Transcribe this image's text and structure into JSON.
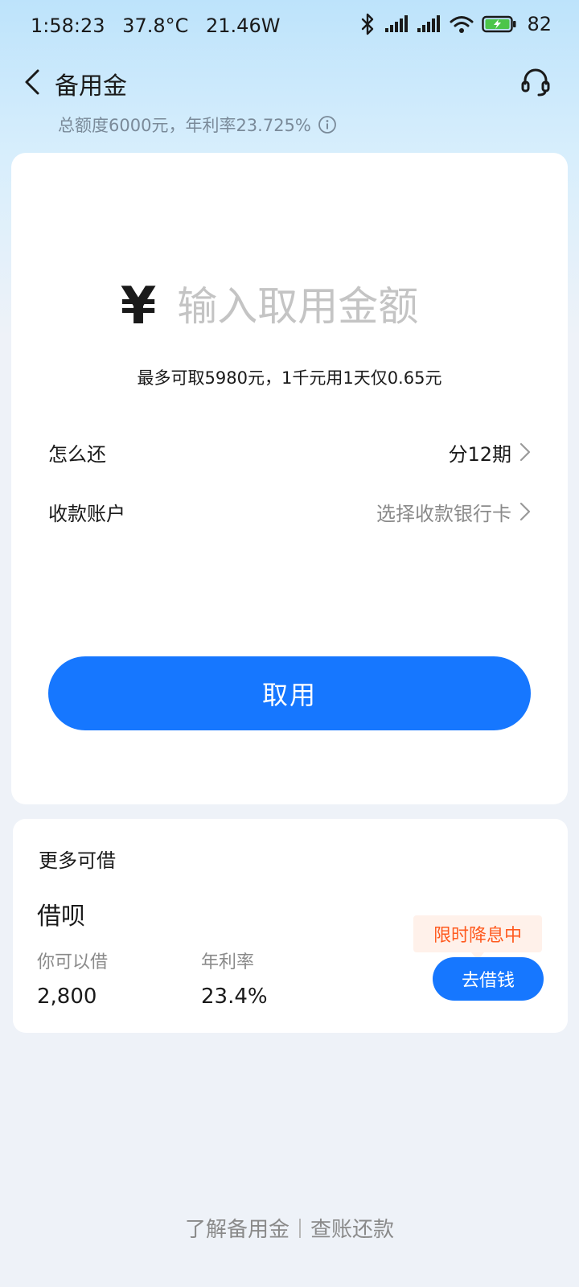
{
  "status_bar": {
    "time": "1:58:23",
    "temperature": "37.8°C",
    "power": "21.46W",
    "battery_level": "82",
    "icons": [
      "bluetooth-icon",
      "signal-icon",
      "signal-icon",
      "wifi-icon",
      "battery-charging-icon"
    ]
  },
  "header": {
    "title": "备用金",
    "subtitle": "总额度6000元，年利率23.725%",
    "back_icon": "chevron-left-icon",
    "service_icon": "headset-icon",
    "info_icon": "info-icon"
  },
  "main": {
    "currency_symbol": "¥",
    "amount_placeholder": "输入取用金额",
    "limit_hint": "最多可取5980元，1千元用1天仅0.65元",
    "repay_label": "怎么还",
    "repay_value": "分12期",
    "account_label": "收款账户",
    "account_value": "选择收款银行卡",
    "submit_label": "取用"
  },
  "more": {
    "title": "更多可借",
    "product_name": "借呗",
    "borrow_label": "你可以借",
    "borrow_value": "2,800",
    "rate_label": "年利率",
    "rate_value": "23.4%",
    "promo_tag": "限时降息中",
    "button_label": "去借钱"
  },
  "footer": {
    "learn_link": "了解备用金",
    "bill_link": "查账还款"
  },
  "colors": {
    "primary": "#1677ff",
    "promo_text": "#ff5a1f",
    "promo_bg": "#fff1ea"
  }
}
